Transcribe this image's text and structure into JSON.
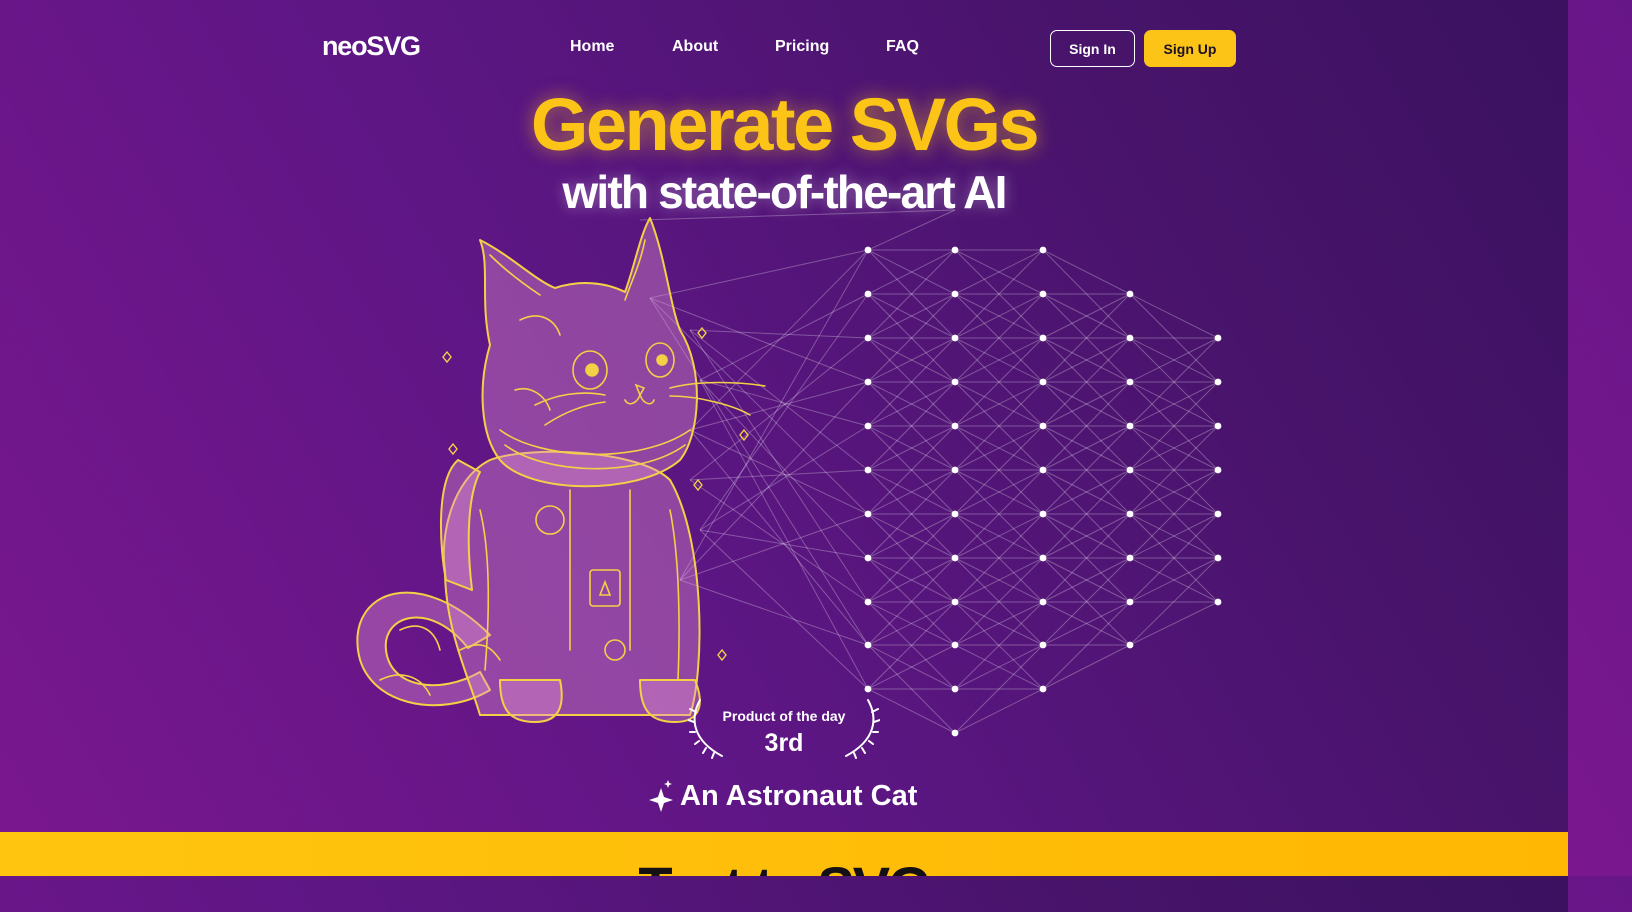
{
  "brand": {
    "logo": "neoSVG"
  },
  "nav": {
    "links": [
      "Home",
      "About",
      "Pricing",
      "FAQ"
    ],
    "sign_in": "Sign In",
    "sign_up": "Sign Up"
  },
  "hero": {
    "title": "Generate SVGs",
    "subtitle": "with state-of-the-art AI"
  },
  "award": {
    "label": "Product of the day",
    "rank": "3rd"
  },
  "showcase": {
    "caption": "An Astronaut Cat",
    "icon": "sparkles-icon"
  },
  "next_section": {
    "title": "Text to SVG"
  },
  "colors": {
    "accent": "#fcc417",
    "background": "#5e1685",
    "line_art": "#f3d146"
  }
}
